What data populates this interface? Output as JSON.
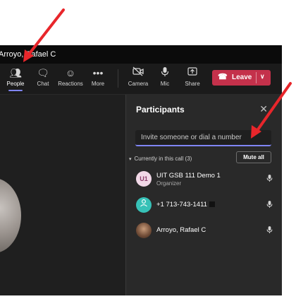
{
  "window": {
    "title": "Arroyo, Rafael C"
  },
  "toolbar": {
    "people": "People",
    "chat": "Chat",
    "reactions": "Reactions",
    "more": "More",
    "camera": "Camera",
    "mic": "Mic",
    "share": "Share",
    "leave": "Leave"
  },
  "participants_panel": {
    "title": "Participants",
    "invite_placeholder": "Invite someone or dial a number",
    "section_label": "Currently in this call (3)",
    "mute_all": "Mute all",
    "participants": [
      {
        "initials": "U1",
        "name": "UIT GSB 111 Demo 1",
        "role": "Organizer"
      },
      {
        "name": "+1 713-743-1411"
      },
      {
        "name": "Arroyo, Rafael C"
      }
    ]
  },
  "colors": {
    "accent": "#7f85f5",
    "leave": "#c4314b",
    "annotation_arrow": "#e8262b"
  },
  "icons": [
    "people-icon",
    "chat-icon",
    "reactions-icon",
    "more-icon",
    "camera-off-icon",
    "mic-icon",
    "share-icon",
    "phone-icon",
    "chevron-down-icon",
    "close-icon",
    "mic-icon",
    "person-icon"
  ]
}
